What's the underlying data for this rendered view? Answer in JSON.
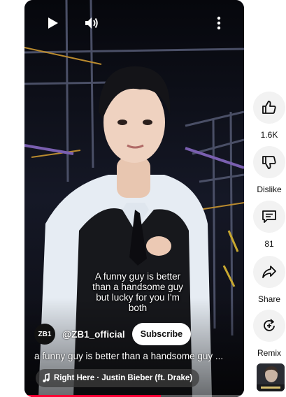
{
  "video": {
    "caption": "A funny guy is better than a handsome guy but lucky for you I'm both",
    "channel": {
      "avatar_text": "ZB1",
      "name": "@ZB1_official",
      "subscribe_label": "Subscribe"
    },
    "title": "a funny guy is better than a handsome guy ...",
    "music": "Right Here · Justin Bieber (ft. Drake)",
    "progress": 0.62
  },
  "actions": {
    "like_count": "1.6K",
    "dislike_label": "Dislike",
    "comments_count": "81",
    "share_label": "Share",
    "remix_label": "Remix"
  },
  "icons": [
    "play-icon",
    "volume-icon",
    "more-vert-icon",
    "thumb-up-icon",
    "thumb-down-icon",
    "comment-icon",
    "share-icon",
    "remix-icon",
    "music-note-icon"
  ],
  "colors": {
    "accent": "#ff0033",
    "button_bg": "#f2f2f2"
  }
}
